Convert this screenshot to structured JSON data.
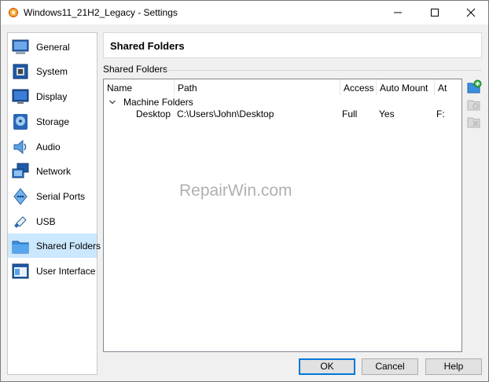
{
  "window": {
    "title": "Windows11_21H2_Legacy - Settings"
  },
  "sidebar": {
    "items": [
      {
        "label": "General",
        "icon": "general-icon"
      },
      {
        "label": "System",
        "icon": "system-icon"
      },
      {
        "label": "Display",
        "icon": "display-icon"
      },
      {
        "label": "Storage",
        "icon": "storage-icon"
      },
      {
        "label": "Audio",
        "icon": "audio-icon"
      },
      {
        "label": "Network",
        "icon": "network-icon"
      },
      {
        "label": "Serial Ports",
        "icon": "serial-ports-icon"
      },
      {
        "label": "USB",
        "icon": "usb-icon"
      },
      {
        "label": "Shared Folders",
        "icon": "shared-folders-icon"
      },
      {
        "label": "User Interface",
        "icon": "user-interface-icon"
      }
    ],
    "selected": "Shared Folders"
  },
  "main": {
    "title": "Shared Folders",
    "section_label": "Shared Folders",
    "table": {
      "columns": [
        "Name",
        "Path",
        "Access",
        "Auto Mount",
        "At"
      ],
      "group": "Machine Folders",
      "rows": [
        {
          "name": "Desktop",
          "path": "C:\\Users\\John\\Desktop",
          "access": "Full",
          "auto_mount": "Yes",
          "at": "F:"
        }
      ]
    }
  },
  "watermark": "RepairWin.com",
  "buttons": {
    "ok": "OK",
    "cancel": "Cancel",
    "help": "Help"
  },
  "colors": {
    "selection": "#cce8ff",
    "default_button_border": "#0078d7"
  }
}
